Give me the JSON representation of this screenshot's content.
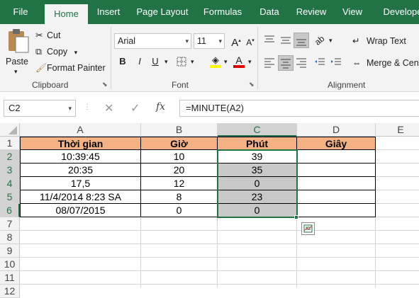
{
  "tabs": [
    {
      "label": "File"
    },
    {
      "label": "Home",
      "active": true
    },
    {
      "label": "Insert"
    },
    {
      "label": "Page Layout"
    },
    {
      "label": "Formulas"
    },
    {
      "label": "Data"
    },
    {
      "label": "Review"
    },
    {
      "label": "View"
    },
    {
      "label": "Develope"
    }
  ],
  "clipboard": {
    "paste": "Paste",
    "cut": "Cut",
    "copy": "Copy",
    "format_painter": "Format Painter",
    "group_label": "Clipboard"
  },
  "font": {
    "name": "Arial",
    "size": "11",
    "bold": "B",
    "italic": "I",
    "underline": "U",
    "grow": "A",
    "shrink": "A",
    "group_label": "Font"
  },
  "alignment": {
    "wrap_text": "Wrap Text",
    "merge_center": "Merge & Cent",
    "group_label": "Alignment"
  },
  "formula_bar": {
    "name_box": "C2",
    "fx": "fx",
    "formula": "=MINUTE(A2)"
  },
  "sheet": {
    "columns": [
      "A",
      "B",
      "C",
      "D",
      "E"
    ],
    "rows": [
      "1",
      "2",
      "3",
      "4",
      "5",
      "6",
      "7",
      "8",
      "9",
      "10",
      "11",
      "12"
    ],
    "header_row": [
      "Thời gian",
      "Giờ",
      "Phút",
      "Giây"
    ],
    "data": [
      [
        "10:39:45",
        "10",
        "39",
        ""
      ],
      [
        "20:35",
        "20",
        "35",
        ""
      ],
      [
        "17,5",
        "12",
        "0",
        ""
      ],
      [
        "11/4/2014 8:23 SA",
        "8",
        "23",
        ""
      ],
      [
        "08/07/2015",
        "0",
        "0",
        ""
      ]
    ]
  },
  "colors": {
    "accent": "#217346",
    "header_fill": "#f4b183",
    "selection": "#c8c8c8"
  }
}
